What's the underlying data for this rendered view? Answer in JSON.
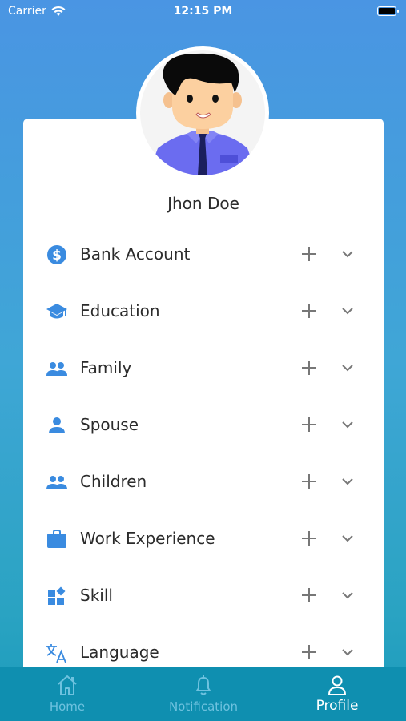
{
  "status": {
    "carrier": "Carrier",
    "time": "12:15 PM"
  },
  "profile": {
    "name": "Jhon Doe"
  },
  "sections": [
    {
      "label": "Bank Account",
      "icon": "dollar-circle-icon"
    },
    {
      "label": "Education",
      "icon": "graduation-cap-icon"
    },
    {
      "label": "Family",
      "icon": "people-icon"
    },
    {
      "label": "Spouse",
      "icon": "person-icon"
    },
    {
      "label": "Children",
      "icon": "people-icon"
    },
    {
      "label": "Work Experience",
      "icon": "briefcase-icon"
    },
    {
      "label": "Skill",
      "icon": "widgets-icon"
    },
    {
      "label": "Language",
      "icon": "translate-icon"
    }
  ],
  "tabs": [
    {
      "label": "Home",
      "icon": "home-icon",
      "active": false
    },
    {
      "label": "Notification",
      "icon": "bell-icon",
      "active": false
    },
    {
      "label": "Profile",
      "icon": "user-icon",
      "active": true
    }
  ],
  "colors": {
    "accent": "#3a8be0",
    "icon_gray": "#777777",
    "tab_bar": "#0f8fb0",
    "tab_inactive": "#6ec2df"
  }
}
